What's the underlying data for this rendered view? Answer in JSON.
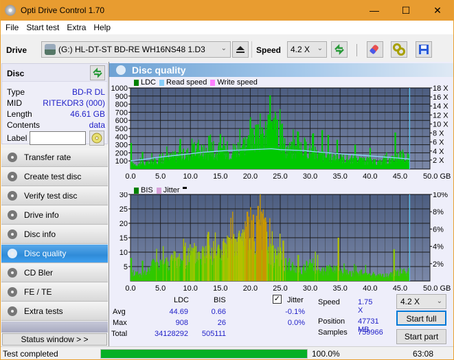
{
  "window": {
    "title": "Opti Drive Control 1.70",
    "minimize": "—",
    "maximize": "☐",
    "close": "✕"
  },
  "menu": [
    "File",
    "Start test",
    "Extra",
    "Help"
  ],
  "toolbar": {
    "drive_label": "Drive",
    "drive_value": "(G:)  HL-DT-ST BD-RE  WH16NS48 1.D3",
    "speed_label": "Speed",
    "speed_value": "4.2 X",
    "icons": [
      "eject-icon",
      "refresh-icon",
      "erase-icon",
      "settings-icon",
      "save-icon"
    ]
  },
  "disc": {
    "title": "Disc",
    "rows": [
      {
        "key": "Type",
        "value": "BD-R DL"
      },
      {
        "key": "MID",
        "value": "RITEKDR3 (000)"
      },
      {
        "key": "Length",
        "value": "46.61 GB"
      },
      {
        "key": "Contents",
        "value": "data"
      }
    ],
    "label_key": "Label",
    "label_value": ""
  },
  "nav": [
    {
      "label": "Transfer rate",
      "active": false
    },
    {
      "label": "Create test disc",
      "active": false
    },
    {
      "label": "Verify test disc",
      "active": false
    },
    {
      "label": "Drive info",
      "active": false
    },
    {
      "label": "Disc info",
      "active": false
    },
    {
      "label": "Disc quality",
      "active": true
    },
    {
      "label": "CD Bler",
      "active": false
    },
    {
      "label": "FE / TE",
      "active": false
    },
    {
      "label": "Extra tests",
      "active": false
    }
  ],
  "status_window_label": "Status window > >",
  "panel_title": "Disc quality",
  "chart_data": [
    {
      "type": "area",
      "title": "LDC / Read speed",
      "legend": [
        "LDC",
        "Read speed",
        "Write speed"
      ],
      "legend_colors": [
        "#008000",
        "#87cefa",
        "#ff80ff"
      ],
      "legend_position": "top-left",
      "xlabel": "GB",
      "x_ticks": [
        "0.0",
        "5.0",
        "10.0",
        "15.0",
        "20.0",
        "25.0",
        "30.0",
        "35.0",
        "40.0",
        "45.0",
        "50.0 GB"
      ],
      "y_ticks": [
        "100",
        "200",
        "300",
        "400",
        "500",
        "600",
        "700",
        "800",
        "900",
        "1000"
      ],
      "y2_ticks": [
        "2 X",
        "4 X",
        "6 X",
        "8 X",
        "10 X",
        "12 X",
        "14 X",
        "16 X",
        "18 X"
      ],
      "xlim": [
        0,
        50
      ],
      "ylim": [
        0,
        1000
      ],
      "y2lim": [
        0,
        18
      ],
      "grid": true,
      "end_marker_gb": 46.61,
      "ldc_profile": {
        "x": [
          0,
          1,
          2,
          3,
          4,
          5,
          6,
          7,
          8,
          9,
          10,
          11,
          12,
          13,
          14,
          15,
          16,
          17,
          18,
          19,
          20,
          21,
          22,
          23,
          24,
          25,
          26,
          27,
          28,
          29,
          30,
          31,
          32,
          33,
          34,
          35,
          36,
          37,
          38,
          39,
          40,
          41,
          42,
          43,
          44,
          45,
          46,
          46.6
        ],
        "y": [
          90,
          60,
          70,
          80,
          110,
          120,
          140,
          170,
          180,
          190,
          230,
          260,
          240,
          220,
          210,
          220,
          230,
          250,
          300,
          350,
          380,
          420,
          410,
          500,
          550,
          400,
          280,
          260,
          250,
          300,
          250,
          200,
          180,
          160,
          170,
          150,
          140,
          130,
          120,
          110,
          100,
          90,
          100,
          110,
          150,
          200,
          160,
          120
        ]
      },
      "ldc_peaks": {
        "x": [
          0.1,
          2.0,
          8.3,
          10.5,
          13.1,
          15.0,
          21.8,
          23.0,
          23.3,
          23.6,
          24.5,
          25.3,
          28.0,
          30.5,
          32.0,
          33.0,
          34.5,
          37.5,
          40.0,
          44.2
        ],
        "y": [
          320,
          210,
          370,
          310,
          410,
          430,
          430,
          670,
          908,
          590,
          610,
          560,
          460,
          440,
          480,
          420,
          360,
          300,
          260,
          450
        ]
      },
      "read_speed": {
        "x": [
          0,
          2,
          4,
          6,
          8,
          10,
          12,
          14,
          16,
          18,
          20,
          22,
          23.5,
          25,
          27,
          29,
          31,
          33,
          35,
          37,
          39,
          41,
          43,
          45,
          46.6
        ],
        "y": [
          1.8,
          2.1,
          2.5,
          2.8,
          3.1,
          3.4,
          3.7,
          3.9,
          4.1,
          4.2,
          4.3,
          4.4,
          4.5,
          4.3,
          4.2,
          4.1,
          3.8,
          3.6,
          3.4,
          3.2,
          3.0,
          2.8,
          2.6,
          2.4,
          2.2
        ]
      }
    },
    {
      "type": "area",
      "title": "BIS / Jitter",
      "legend": [
        "BIS",
        "Jitter"
      ],
      "legend_colors": [
        "#008000",
        "#d8a0d8"
      ],
      "legend_position": "top-left",
      "xlabel": "GB",
      "x_ticks": [
        "0.0",
        "5.0",
        "10.0",
        "15.0",
        "20.0",
        "25.0",
        "30.0",
        "35.0",
        "40.0",
        "45.0",
        "50.0 GB"
      ],
      "y_ticks": [
        "5",
        "10",
        "15",
        "20",
        "25",
        "30"
      ],
      "y2_ticks": [
        "2%",
        "4%",
        "6%",
        "8%",
        "10%"
      ],
      "xlim": [
        0,
        50
      ],
      "ylim": [
        0,
        30
      ],
      "y2lim": [
        0,
        10
      ],
      "grid": true,
      "end_marker_gb": 46.61,
      "bis_profile": {
        "x": [
          0,
          1,
          2,
          3,
          4,
          5,
          6,
          7,
          8,
          9,
          10,
          11,
          12,
          13,
          14,
          15,
          16,
          17,
          18,
          19,
          20,
          21,
          22,
          23,
          24,
          25,
          26,
          27,
          28,
          29,
          30,
          31,
          32,
          33,
          34,
          35,
          36,
          37,
          38,
          39,
          40,
          41,
          42,
          43,
          44,
          45,
          46,
          46.6
        ],
        "y": [
          3,
          3,
          2,
          4,
          7,
          7,
          7,
          8,
          8,
          9,
          10,
          10,
          10,
          11,
          11,
          11,
          12,
          12,
          14,
          17,
          19,
          20,
          18,
          14,
          10,
          8,
          6,
          5,
          4,
          5,
          6,
          5,
          4,
          4,
          5,
          4,
          3,
          3,
          3,
          3,
          2,
          2,
          2,
          2,
          3,
          3,
          3,
          2
        ]
      },
      "bis_peaks": {
        "x": [
          0.1,
          2.0,
          9.0,
          13.0,
          16.5,
          19.5,
          20.5,
          21.3,
          22.5,
          25.5,
          28.0,
          34.7,
          44.0
        ],
        "y": [
          8,
          7,
          12,
          17,
          15,
          24,
          23,
          26,
          22,
          14,
          9,
          15,
          11
        ]
      }
    }
  ],
  "stats": {
    "headers": [
      "",
      "LDC",
      "BIS"
    ],
    "rows": [
      {
        "label": "Avg",
        "ldc": "44.69",
        "bis": "0.66",
        "jitter": "-0.1%"
      },
      {
        "label": "Max",
        "ldc": "908",
        "bis": "26",
        "jitter": "0.0%"
      },
      {
        "label": "Total",
        "ldc": "34128292",
        "bis": "505111",
        "jitter": ""
      }
    ],
    "jitter_label": "Jitter",
    "jitter_checked": true,
    "speed_label": "Speed",
    "speed_value": "1.75 X",
    "position_label": "Position",
    "position_value": "47731 MB",
    "samples_label": "Samples",
    "samples_value": "759966",
    "speed_select": "4.2 X",
    "start_full": "Start full",
    "start_part": "Start part"
  },
  "statusbar": {
    "text": "Test completed",
    "progress": 100.0,
    "progress_text": "100.0%",
    "time": "63:08"
  },
  "colors": {
    "accent": "#e89c30",
    "progress": "#06b025",
    "value_blue": "#1e1ec8",
    "chart_bg": "#4f6183",
    "ldc_green": "#00cc00",
    "read_speed": "#7fd4ff"
  }
}
